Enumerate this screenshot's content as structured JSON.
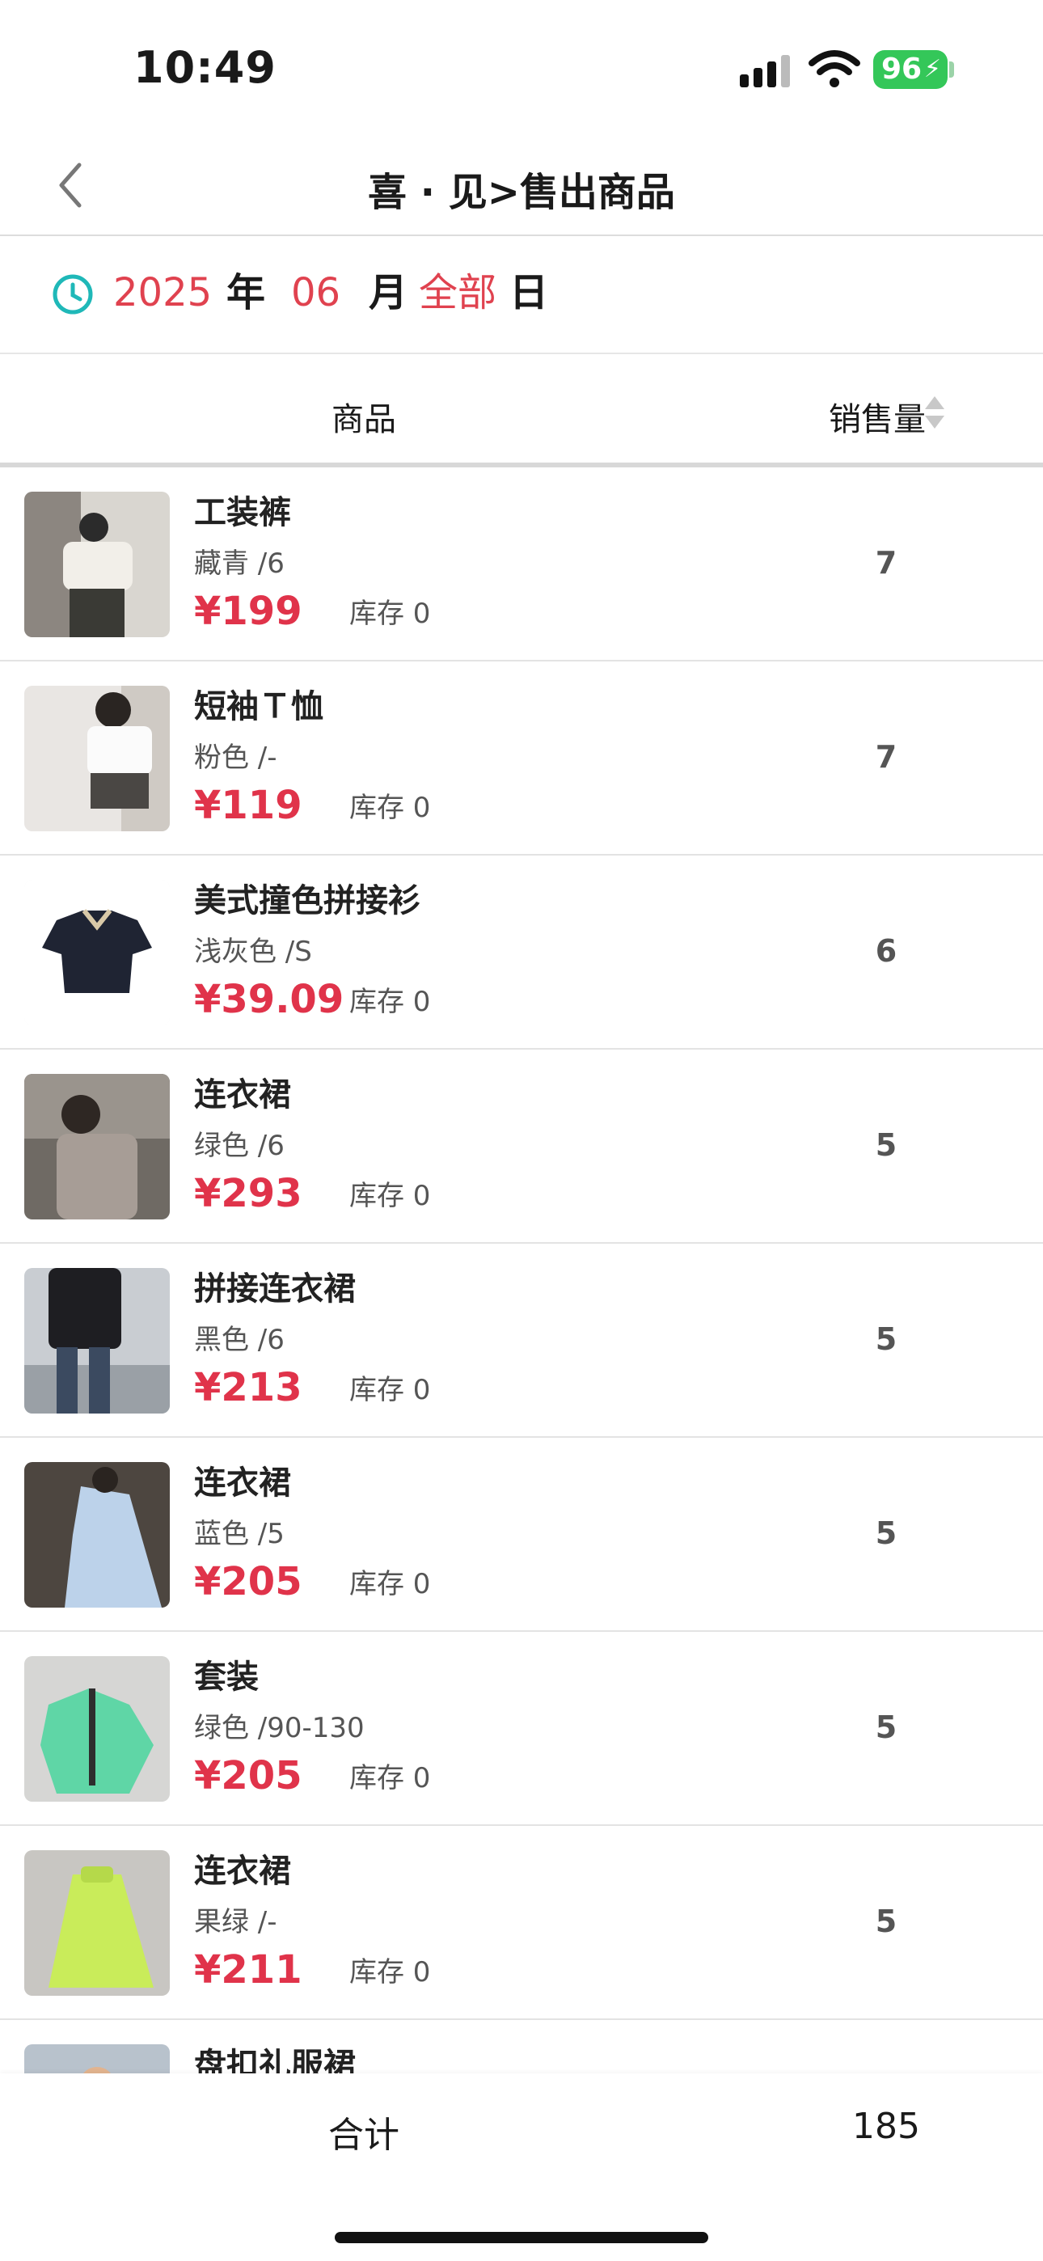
{
  "status_bar": {
    "time": "10:49",
    "battery": "96"
  },
  "nav": {
    "title": "喜 · 见>售出商品"
  },
  "date_filter": {
    "year": "2025",
    "year_unit": "年",
    "month": "06",
    "month_unit": "月",
    "day": "全部",
    "day_unit": "日"
  },
  "table_header": {
    "goods": "商品",
    "sales_qty": "销售量"
  },
  "items": [
    {
      "name": "工装裤",
      "spec": "藏青 /6",
      "price": "¥199",
      "stock": "库存 0",
      "qty": "7"
    },
    {
      "name": "短袖Ｔ恤",
      "spec": "粉色 /-",
      "price": "¥119",
      "stock": "库存 0",
      "qty": "7"
    },
    {
      "name": "美式撞色拼接衫",
      "spec": "浅灰色 /S",
      "price": "¥39.09",
      "stock": "库存 0",
      "qty": "6"
    },
    {
      "name": "连衣裙",
      "spec": "绿色 /6",
      "price": "¥293",
      "stock": "库存 0",
      "qty": "5"
    },
    {
      "name": "拼接连衣裙",
      "spec": "黑色 /6",
      "price": "¥213",
      "stock": "库存 0",
      "qty": "5"
    },
    {
      "name": "连衣裙",
      "spec": "蓝色 /5",
      "price": "¥205",
      "stock": "库存 0",
      "qty": "5"
    },
    {
      "name": "套装",
      "spec": "绿色 /90-130",
      "price": "¥205",
      "stock": "库存 0",
      "qty": "5"
    },
    {
      "name": "连衣裙",
      "spec": "果绿 /-",
      "price": "¥211",
      "stock": "库存 0",
      "qty": "5"
    },
    {
      "name": "盘扣礼服裙",
      "spec": "",
      "price": "",
      "stock": "",
      "qty": ""
    }
  ],
  "footer": {
    "total_label": "合计",
    "total_value": "185"
  },
  "colors": {
    "accent_red": "#e0334a",
    "clock_teal": "#1fb8b8",
    "battery_green": "#34c759"
  }
}
